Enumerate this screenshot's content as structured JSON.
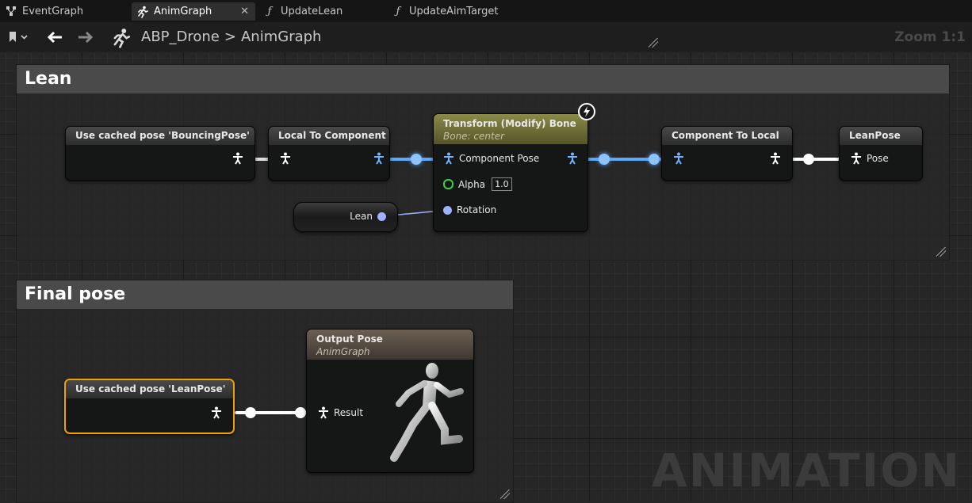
{
  "tabs": [
    {
      "label": "EventGraph",
      "icon": "graph-icon"
    },
    {
      "label": "AnimGraph",
      "icon": "running-man-icon",
      "close": "✕"
    },
    {
      "label": "UpdateLean",
      "icon": "function-icon"
    },
    {
      "label": "UpdateAimTarget",
      "icon": "function-icon"
    }
  ],
  "breadcrumb": {
    "root": "ABP_Drone",
    "separator": ">",
    "current": "AnimGraph"
  },
  "zoom": "Zoom 1:1",
  "watermark": "ANIMATION",
  "comments": [
    {
      "title": "Lean"
    },
    {
      "title": "Final pose"
    }
  ],
  "nodes": {
    "cached_bouncing": {
      "title": "Use cached pose 'BouncingPose'"
    },
    "local_to_component": {
      "title": "Local To Component"
    },
    "transform_bone": {
      "title": "Transform (Modify) Bone",
      "subtitle": "Bone: center",
      "pins": {
        "component_pose": "Component Pose",
        "alpha": "Alpha",
        "alpha_value": "1.0",
        "rotation": "Rotation"
      }
    },
    "component_to_local": {
      "title": "Component To Local"
    },
    "lean_pose": {
      "title": "LeanPose",
      "pin": "Pose"
    },
    "lean_var": {
      "label": "Lean"
    },
    "cached_lean": {
      "title": "Use cached pose 'LeanPose'"
    },
    "output_pose": {
      "title": "Output Pose",
      "subtitle": "AnimGraph",
      "pin": "Result"
    }
  },
  "colors": {
    "pose_wire": "#ffffff",
    "space_wire": "#5aa9ff",
    "rotator_wire": "#a0b0ff",
    "selected": "#f0a000",
    "transform_header": "#7a7a3a"
  }
}
